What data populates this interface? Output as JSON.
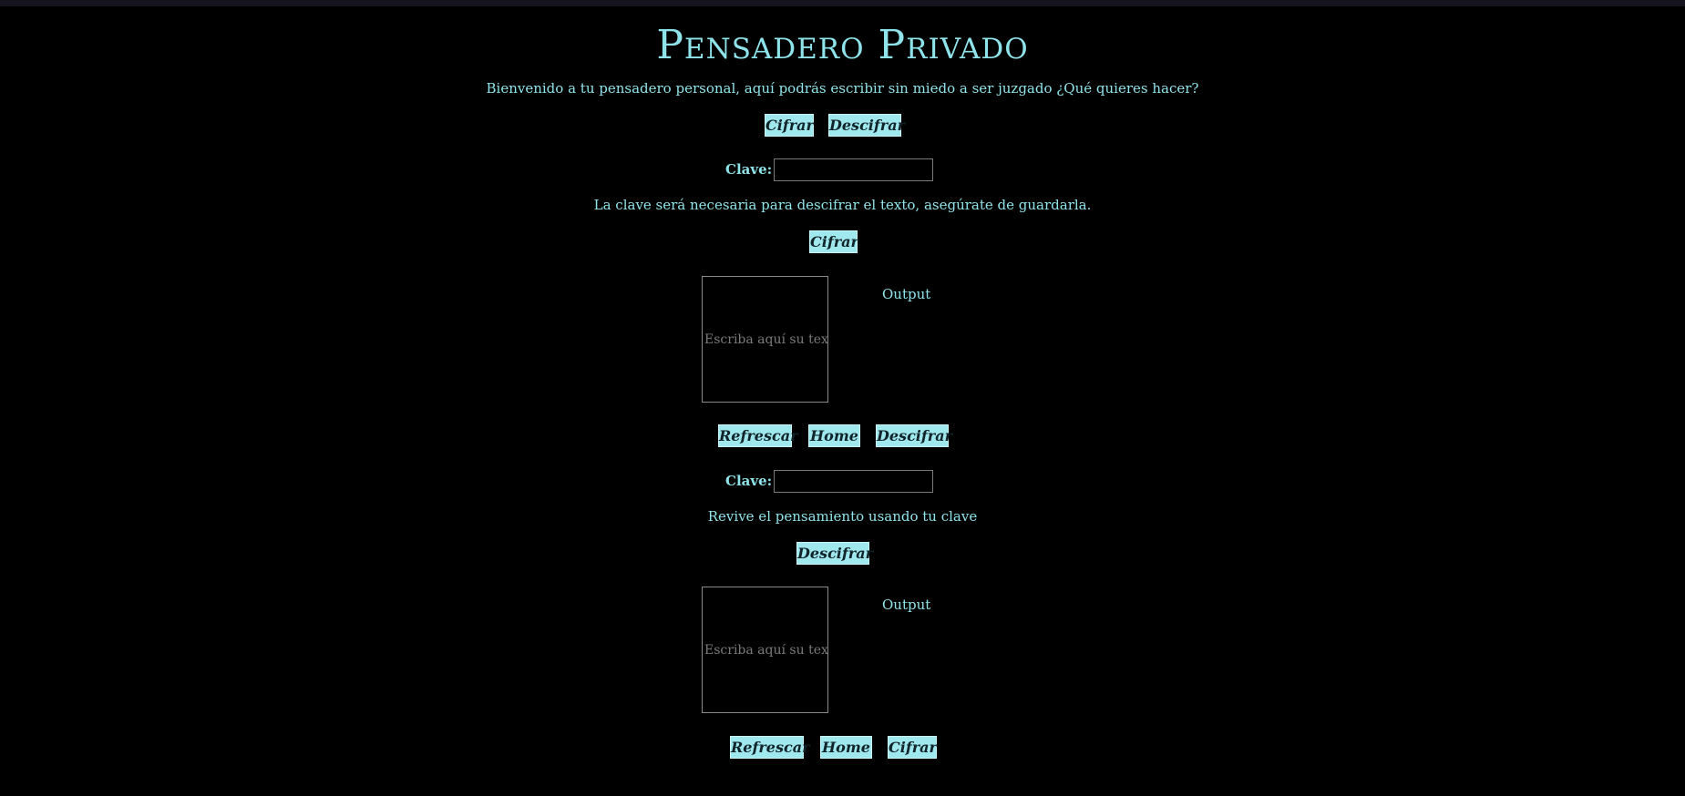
{
  "header": {
    "title": "Pensadero Privado",
    "welcome": "Bienvenido a tu pensadero personal, aquí podrás escribir sin miedo a ser juzgado ¿Qué quieres hacer?"
  },
  "nav": {
    "cifrar_label": "Cifrar",
    "descifrar_label": "Descifrar"
  },
  "encrypt": {
    "key_label": "Clave:",
    "key_value": "",
    "hint": "La clave será necesaria para descifrar el texto, asegúrate de guardarla.",
    "action_label": "Cifrar",
    "text_placeholder": "Escriba aquí su texto",
    "output_label": "Output",
    "refresh_label": "Refrescar",
    "home_label": "Home",
    "switch_label": "Descifrar"
  },
  "decrypt": {
    "key_label": "Clave:",
    "key_value": "",
    "hint": "Revive el pensamiento usando tu clave",
    "action_label": "Descifrar",
    "text_placeholder": "Escriba aquí su texto",
    "output_label": "Output",
    "refresh_label": "Refrescar",
    "home_label": "Home",
    "switch_label": "Cifrar"
  },
  "colors": {
    "background": "#000000",
    "accent_text": "#8fe3ea",
    "button_bg": "#9fe8ee",
    "button_text": "#10242a"
  }
}
